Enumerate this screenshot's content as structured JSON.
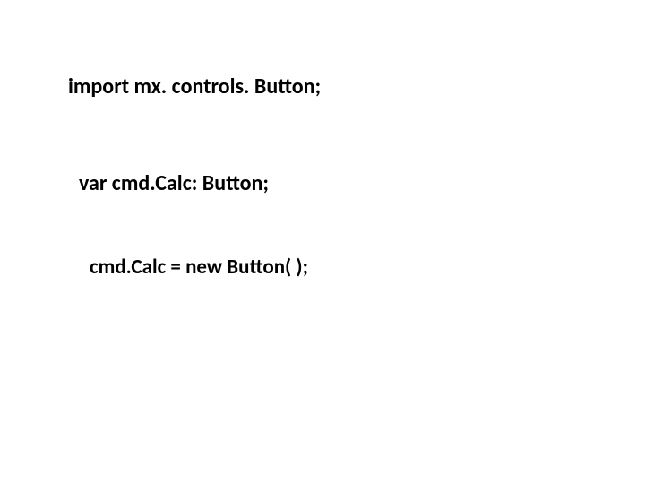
{
  "code": {
    "line1": "import mx. controls. Button;",
    "line2": "var cmd.Calc: Button;",
    "line3": "cmd.Calc = new Button( );"
  }
}
